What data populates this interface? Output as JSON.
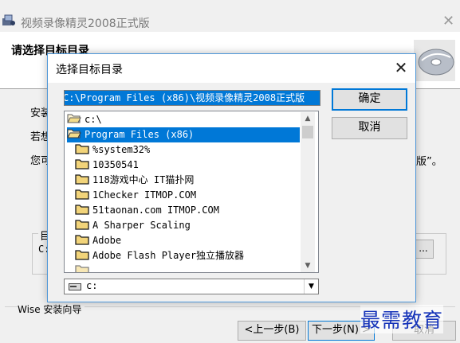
{
  "window": {
    "title": "视频录像精灵2008正式版",
    "header_title": "请选择目标目录",
    "body_lines": [
      "安装",
      "若想",
      "您可"
    ],
    "body_suffix": "版”。",
    "group_label": "目",
    "dest_path_prefix": "C:",
    "browse_label": "...",
    "brand": "Wise 安装向导",
    "back_label": "<上一步(B)",
    "next_label": "下一步(N) >",
    "cancel_label": "取消"
  },
  "dialog": {
    "title": "选择目标目录",
    "path_value": "C:\\Program Files (x86)\\视频录像精灵2008正式版",
    "ok_label": "确定",
    "cancel_label": "取消",
    "tree": [
      {
        "label": "c:\\",
        "open": true,
        "selected": false,
        "level": 0
      },
      {
        "label": "Program Files (x86)",
        "open": true,
        "selected": true,
        "level": 0
      },
      {
        "label": "%system32%",
        "open": false,
        "selected": false,
        "level": 1
      },
      {
        "label": "10350541",
        "open": false,
        "selected": false,
        "level": 1
      },
      {
        "label": "118游戏中心 IT猫扑网",
        "open": false,
        "selected": false,
        "level": 1
      },
      {
        "label": "1Checker ITMOP.COM",
        "open": false,
        "selected": false,
        "level": 1
      },
      {
        "label": "51taonan.com ITMOP.COM",
        "open": false,
        "selected": false,
        "level": 1
      },
      {
        "label": "A Sharper Scaling",
        "open": false,
        "selected": false,
        "level": 1
      },
      {
        "label": "Adobe",
        "open": false,
        "selected": false,
        "level": 1
      },
      {
        "label": "Adobe Flash Player独立播放器",
        "open": false,
        "selected": false,
        "level": 1
      }
    ],
    "drive_value": "c:"
  },
  "watermark": "最需教育",
  "colors": {
    "selection": "#0078d7",
    "folder": "#e8c060",
    "watermark": "#1533b9"
  }
}
